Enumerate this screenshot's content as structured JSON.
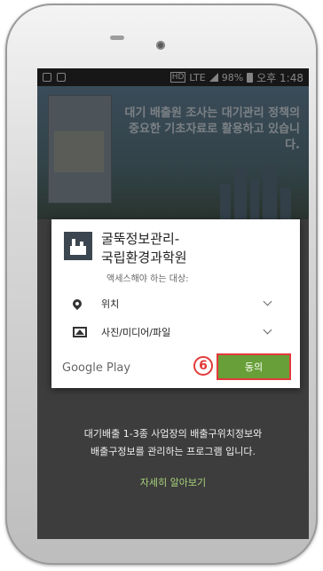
{
  "status_bar": {
    "battery": "98%",
    "time": "오후 1:48",
    "network": "LTE",
    "hd": "HD"
  },
  "banner": {
    "headline_1": "대기 배출원 조사는 대기관리 정책의",
    "headline_2": "중요한 기초자료로 활용하고 있습니다."
  },
  "dialog": {
    "app_name_line1": "굴뚝정보관리-",
    "app_name_line2": "국립환경과학원",
    "access_text": "액세스해야 하는 대상:",
    "permissions": [
      {
        "icon": "location-pin-icon",
        "label": "위치"
      },
      {
        "icon": "photo-media-icon",
        "label": "사진/미디어/파일"
      }
    ],
    "store_label": "Google Play",
    "step_number": "6",
    "agree_label": "동의"
  },
  "page": {
    "desc_line1": "대기배출 1-3종 사업장의 배출구위치정보와",
    "desc_line2": "배출구정보를 관리하는 프로그램 입니다.",
    "more_link": "자세히 알아보기"
  }
}
